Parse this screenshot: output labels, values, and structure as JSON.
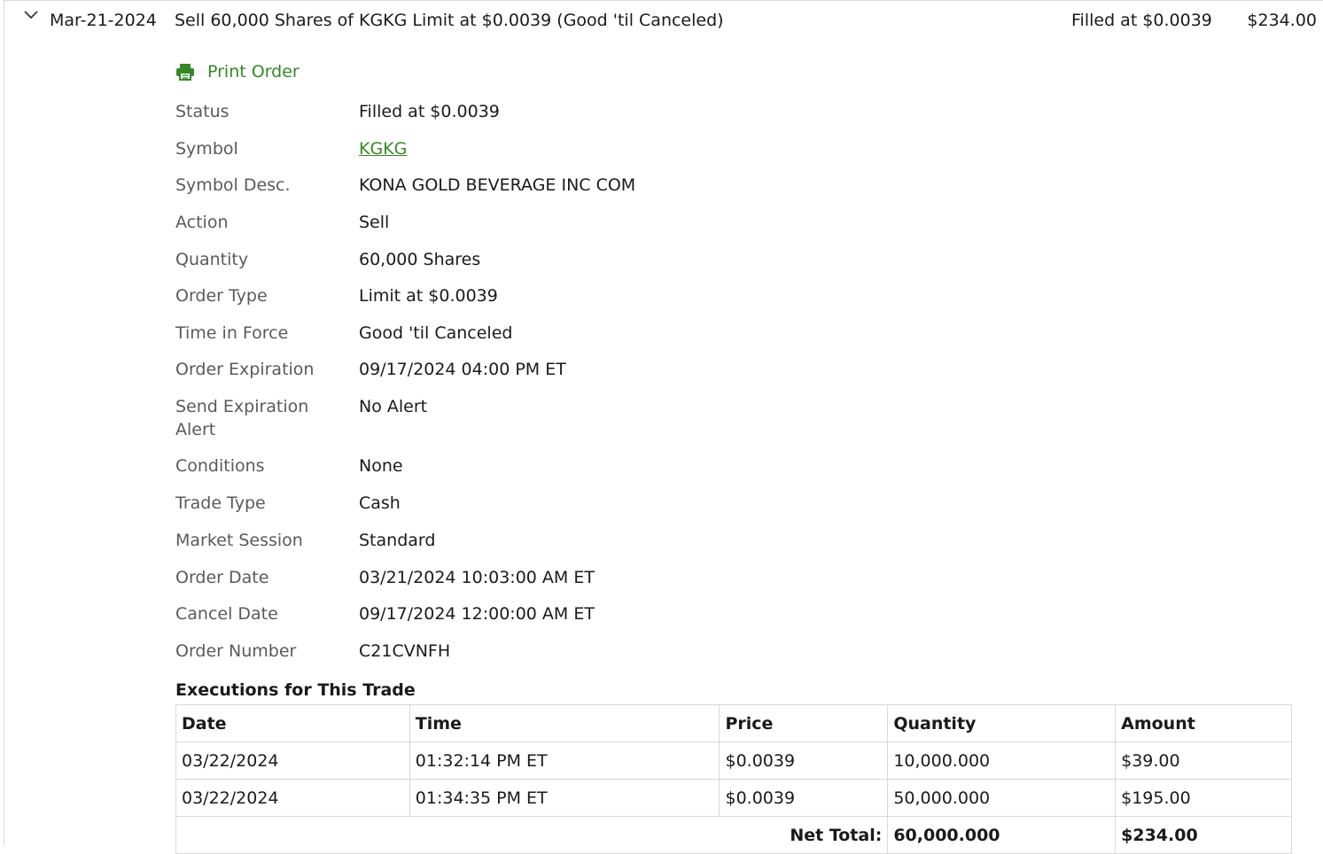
{
  "order": {
    "date": "Mar-21-2024",
    "description": "Sell 60,000 Shares of KGKG Limit at $0.0039 (Good 'til Canceled)",
    "status": "Filled at $0.0039",
    "amount": "$234.00"
  },
  "print_order_label": "Print Order",
  "details": [
    {
      "label": "Status",
      "value": "Filled at $0.0039"
    },
    {
      "label": "Symbol",
      "value": "KGKG"
    },
    {
      "label": "Symbol Desc.",
      "value": "KONA GOLD BEVERAGE INC COM"
    },
    {
      "label": "Action",
      "value": "Sell"
    },
    {
      "label": "Quantity",
      "value": "60,000 Shares"
    },
    {
      "label": "Order Type",
      "value": "Limit at $0.0039"
    },
    {
      "label": "Time in Force",
      "value": "Good 'til Canceled"
    },
    {
      "label": "Order Expiration",
      "value": "09/17/2024 04:00 PM ET"
    },
    {
      "label": "Send Expiration Alert",
      "value": "No Alert"
    },
    {
      "label": "Conditions",
      "value": "None"
    },
    {
      "label": "Trade Type",
      "value": "Cash"
    },
    {
      "label": "Market Session",
      "value": "Standard"
    },
    {
      "label": "Order Date",
      "value": "03/21/2024 10:03:00 AM ET"
    },
    {
      "label": "Cancel Date",
      "value": "09/17/2024 12:00:00 AM ET"
    },
    {
      "label": "Order Number",
      "value": "C21CVNFH"
    }
  ],
  "executions": {
    "title": "Executions for This Trade",
    "headers": [
      "Date",
      "Time",
      "Price",
      "Quantity",
      "Amount"
    ],
    "rows": [
      [
        "03/22/2024",
        "01:32:14 PM ET",
        "$0.0039",
        "10,000.000",
        "$39.00"
      ],
      [
        "03/22/2024",
        "01:34:35 PM ET",
        "$0.0039",
        "50,000.000",
        "$195.00"
      ]
    ],
    "net_total_label": "Net Total:",
    "net_total_quantity": "60,000.000",
    "net_total_amount": "$234.00"
  },
  "colors": {
    "link_green": "#368727",
    "label_gray": "#5a5a5a",
    "border": "#d9d9d9"
  },
  "icons": {
    "chevron": "chevron-down-icon",
    "print": "printer-icon"
  }
}
